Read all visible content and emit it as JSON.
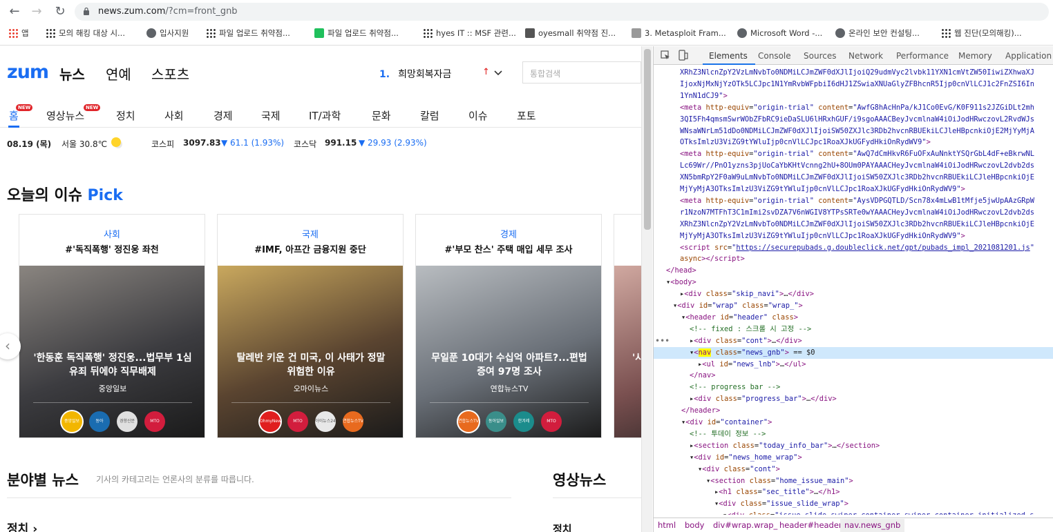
{
  "browser": {
    "url_host": "news.zum.com",
    "url_path": "/?cm=front_gnb",
    "bookmarks": [
      {
        "label": "앱",
        "icon": "apps-grid-icon"
      },
      {
        "label": "모의 해킹 대상 시...",
        "icon": "dots-icon"
      },
      {
        "label": "입사지원",
        "icon": "globe-icon"
      },
      {
        "label": "파일 업로드 취약점...",
        "icon": "dots-icon"
      },
      {
        "label": "파일 업로드 취약점...",
        "icon": "blog-icon"
      },
      {
        "label": "hyes IT :: MSF 관련...",
        "icon": "dots-icon"
      },
      {
        "label": "oyesmall 취약점 진...",
        "icon": "window-icon"
      },
      {
        "label": "3. Metasploit Fram...",
        "icon": "wiki-icon"
      },
      {
        "label": "Microsoft Word -...",
        "icon": "globe-icon"
      },
      {
        "label": "온라인 보안 컨설팅...",
        "icon": "globe-icon"
      },
      {
        "label": "웹 진단(모의해킹)...",
        "icon": "dots-icon"
      }
    ]
  },
  "site": {
    "logo": "zum",
    "top_tabs": [
      "뉴스",
      "연예",
      "스포츠"
    ],
    "rank_number": "1.",
    "rank_text": "희망회복자금",
    "rank_arrow": "↑",
    "search_placeholder": "통합검색",
    "gnb": [
      {
        "label": "홈",
        "new": true
      },
      {
        "label": "영상뉴스",
        "new": true
      },
      {
        "label": "정치",
        "new": false
      },
      {
        "label": "사회",
        "new": false
      },
      {
        "label": "경제",
        "new": false
      },
      {
        "label": "국제",
        "new": false
      },
      {
        "label": "IT/과학",
        "new": false
      },
      {
        "label": "문화",
        "new": false
      },
      {
        "label": "칼럼",
        "new": false
      },
      {
        "label": "이슈",
        "new": false
      },
      {
        "label": "포토",
        "new": false
      }
    ],
    "new_badge": "NEW",
    "info_bar": {
      "date": "08.19 (목)",
      "weather": "서울 30.8℃",
      "kospi_label": "코스피",
      "kospi_value": "3097.83",
      "kospi_change": "▼ 61.1 (1.93%)",
      "kosdaq_label": "코스닥",
      "kosdaq_value": "991.15",
      "kosdaq_change": "▼ 29.93 (2.93%)"
    },
    "issue_title": "오늘의 이슈",
    "issue_pick": "Pick",
    "cards": [
      {
        "category": "사회",
        "headline": "#'독직폭행' 정진웅 좌천",
        "caption": "'한동훈 독직폭행' 정진웅...법무부 1심 유죄 뒤에야 직무배제",
        "source": "중앙일보",
        "colors": [
          "#3c3c40",
          "#8a8580"
        ],
        "press": [
          {
            "name": "중앙일보",
            "color": "#f2b600"
          },
          {
            "name": "동아",
            "color": "#1a6cb0"
          },
          {
            "name": "경향신문",
            "color": "#e0e0e0"
          },
          {
            "name": "MTO",
            "color": "#d21d3d"
          }
        ]
      },
      {
        "category": "국제",
        "headline": "#IMF, 아프간 금융지원 중단",
        "caption": "탈레반 키운 건 미국, 이 사태가 정말 위험한 이유",
        "source": "오마이뉴스",
        "colors": [
          "#5a4430",
          "#c9a85e"
        ],
        "press": [
          {
            "name": "OhmyNews",
            "color": "#e01e1e"
          },
          {
            "name": "MTO",
            "color": "#d21d3d"
          },
          {
            "name": "아이뉴스24",
            "color": "#e8e8e8"
          },
          {
            "name": "연합뉴스TV",
            "color": "#e86a1e"
          }
        ]
      },
      {
        "category": "경제",
        "headline": "#'부모 찬스' 주택 매입 세무 조사",
        "caption": "무일푼 10대가 수십억 아파트?...편법증여 97명 조사",
        "source": "연합뉴스TV",
        "colors": [
          "#6a7078",
          "#b8bcc0"
        ],
        "press": [
          {
            "name": "연합뉴스TV",
            "color": "#e86a1e"
          },
          {
            "name": "동아일보",
            "color": "#3a8e8a"
          },
          {
            "name": "한겨레",
            "color": "#1b8c8c"
          },
          {
            "name": "MTO",
            "color": "#d21d3d"
          }
        ]
      },
      {
        "category": "",
        "headline": "",
        "caption": "'사",
        "source": "",
        "colors": [
          "#7a5050",
          "#d0a8a0"
        ],
        "press": []
      }
    ],
    "field_title": "분야별 뉴스",
    "field_desc": "기사의 카테고리는 언론사의 분류를 따릅니다.",
    "video_title": "영상뉴스",
    "politics_left": "정치 ›",
    "politics_right": "정치"
  },
  "devtools": {
    "tabs": [
      "Elements",
      "Console",
      "Sources",
      "Network",
      "Performance",
      "Memory",
      "Application"
    ],
    "active_tab": "Elements",
    "lines": [
      {
        "indent": 0,
        "html": "<span class='t-val'>XRhZ3NlcnZpY2VzLmNvbTo0NDMiLCJmZWF0dXJlIjoiQ29udmVyc2lvbk11YXN1cmVtZW50IiwiZXhwaXJ</span>"
      },
      {
        "indent": 0,
        "html": "<span class='t-val'>IjoxNjMxNjYzOTk5LCJpc1N1YmRvbWFpbiI6dHJ1ZSwiaXNUaGlyZFBhcnR5Ijp0cnVlLCJ1c2FnZSI6In</span>"
      },
      {
        "indent": 0,
        "html": "<span class='t-val'>1YnN1dCJ9\"</span><span class='t-tag'>&gt;</span>"
      },
      {
        "indent": 0,
        "html": "<span class='t-tag'>&lt;meta</span> <span class='t-attr'>http-equiv</span>=<span class='t-val'>\"origin-trial\"</span> <span class='t-attr'>content</span>=<span class='t-val'>\"AwfG8hAcHnPa/kJ1Co0EvG/K0F911s2JZGiDLt2mh</span>"
      },
      {
        "indent": 0,
        "html": "<span class='t-val'>3QI5Fh4qmsmSwrWObZFbRC9ieDaSLU6lHRxhGUF/i9sgoAAACBeyJvcmlnaW4iOiJodHRwczovL2RvdWJs</span>"
      },
      {
        "indent": 0,
        "html": "<span class='t-val'>WNsaWNrLm51dDo0NDMiLCJmZWF0dXJlIjoiSW50ZXJlc3RDb2hvcnRBUEkiLCJleHBpcnkiOjE2MjYyMjA</span>"
      },
      {
        "indent": 0,
        "html": "<span class='t-val'>OTksImlzU3ViZG9tYWluIjp0cnVlLCJpc1RoaXJkUGFydHkiOnRydWV9\"</span><span class='t-tag'>&gt;</span>"
      },
      {
        "indent": 0,
        "html": "<span class='t-tag'>&lt;meta</span> <span class='t-attr'>http-equiv</span>=<span class='t-val'>\"origin-trial\"</span> <span class='t-attr'>content</span>=<span class='t-val'>\"AwQ7dCmHkvR6FuOFxAuNnktYSQrGbL4dF+eBkrwNL</span>"
      },
      {
        "indent": 0,
        "html": "<span class='t-val'>Lc69Wr//PnO1yzns3pjUoCaYbKHtVcnng2hU+8OUm0PAYAAACHeyJvcmlnaW4iOiJodHRwczovL2dvb2ds</span>"
      },
      {
        "indent": 0,
        "html": "<span class='t-val'>XN5bmRpY2F0aW9uLmNvbTo0NDMiLCJmZWF0dXJlIjoiSW50ZXJlc3RDb2hvcnRBUEkiLCJleHBpcnkiOjE</span>"
      },
      {
        "indent": 0,
        "html": "<span class='t-val'>MjYyMjA3OTksImlzU3ViZG9tYWluIjp0cnVlLCJpc1RoaXJkUGFydHkiOnRydWV9\"</span><span class='t-tag'>&gt;</span>"
      },
      {
        "indent": 0,
        "html": "<span class='t-tag'>&lt;meta</span> <span class='t-attr'>http-equiv</span>=<span class='t-val'>\"origin-trial\"</span> <span class='t-attr'>content</span>=<span class='t-val'>\"AysVDPGQTLD/Scn78x4mLwB1tMfje5jwUpAAzGRpW</span>"
      },
      {
        "indent": 0,
        "html": "<span class='t-val'>r1NzoN7MTFhT3C1mImi2svDZA7V6nWGIV8YTPsSRTe0wYAAACHeyJvcmlnaW4iOiJodHRwczovL2dvb2ds</span>"
      },
      {
        "indent": 0,
        "html": "<span class='t-val'>XRhZ3NlcnZpY2VzLmNvbTo0NDMiLCJmZWF0dXJlIjoiSW50ZXJlc3RDb2hvcnRBUEkiLCJleHBpcnkiOjE</span>"
      },
      {
        "indent": 0,
        "html": "<span class='t-val'>MjYyMjA3OTksImlzU3ViZG9tYWluIjp0cnVlLCJpc1RoaXJkUGFydHkiOnRydWV9\"</span><span class='t-tag'>&gt;</span>"
      },
      {
        "indent": 0,
        "html": "<span class='t-tag'>&lt;script</span> <span class='t-attr'>src</span>=<span class='t-val'>\"</span><span class='t-link'>https://securepubads.g.doubleclick.net/gpt/pubads_impl_2021081201.js</span><span class='t-val'>\"</span>"
      },
      {
        "indent": 0,
        "html": "<span class='t-attr'>async</span><span class='t-tag'>&gt;&lt;/script&gt;</span>"
      },
      {
        "indent": -1,
        "html": "<span class='t-tag'>&lt;/head&gt;</span>"
      },
      {
        "indent": -1,
        "html": "<span class='t-txt'>▾</span><span class='t-tag'>&lt;body&gt;</span>"
      },
      {
        "indent": 0,
        "html": "<span class='t-txt'>▸</span><span class='t-tag'>&lt;div</span> <span class='t-attr'>class</span>=<span class='t-val'>\"skip_navi\"</span><span class='t-tag'>&gt;</span>…<span class='t-tag'>&lt;/div&gt;</span>"
      },
      {
        "indent": 0,
        "html": "<span class='t-txt'>▾</span><span class='t-tag'>&lt;div</span> <span class='t-attr'>id</span>=<span class='t-val'>\"wrap\"</span> <span class='t-attr'>class</span>=<span class='t-val'>\"wrap_\"</span><span class='t-tag'>&gt;</span>"
      },
      {
        "indent": 1,
        "html": "<span class='t-txt'>▾</span><span class='t-tag'>&lt;header</span> <span class='t-attr'>id</span>=<span class='t-val'>\"header\"</span> <span class='t-attr'>class</span><span class='t-tag'>&gt;</span>"
      },
      {
        "indent": 2,
        "html": "<span class='t-cmt'>&lt;!-- fixed : 스크롤 시 고정 --&gt;</span>"
      },
      {
        "indent": 2,
        "html": "<span class='t-txt'>▸</span><span class='t-tag'>&lt;div</span> <span class='t-attr'>class</span>=<span class='t-val'>\"cont\"</span><span class='t-tag'>&gt;</span>…<span class='t-tag'>&lt;/div&gt;</span>"
      },
      {
        "indent": 2,
        "sel": true,
        "html": "<span class='t-txt'>▾</span><span class='t-tag'>&lt;<span class='hl'>nav</span></span> <span class='t-attr'>class</span>=<span class='t-val'>\"news_gnb\"</span><span class='t-tag'>&gt;</span> <span class='t-txt'>== $0</span>"
      },
      {
        "indent": 3,
        "html": "<span class='t-txt'>▸</span><span class='t-tag'>&lt;ul</span> <span class='t-attr'>id</span>=<span class='t-val'>\"news_lnb\"</span><span class='t-tag'>&gt;</span>…<span class='t-tag'>&lt;/ul&gt;</span>"
      },
      {
        "indent": 2,
        "html": "<span class='t-tag'>&lt;/nav&gt;</span>"
      },
      {
        "indent": 2,
        "html": "<span class='t-cmt'>&lt;!-- progress bar --&gt;</span>"
      },
      {
        "indent": 2,
        "html": "<span class='t-txt'>▸</span><span class='t-tag'>&lt;div</span> <span class='t-attr'>class</span>=<span class='t-val'>\"progress_bar\"</span><span class='t-tag'>&gt;</span>…<span class='t-tag'>&lt;/div&gt;</span>"
      },
      {
        "indent": 1,
        "html": "<span class='t-tag'>&lt;/header&gt;</span>"
      },
      {
        "indent": 1,
        "html": "<span class='t-txt'>▾</span><span class='t-tag'>&lt;div</span> <span class='t-attr'>id</span>=<span class='t-val'>\"container\"</span><span class='t-tag'>&gt;</span>"
      },
      {
        "indent": 2,
        "html": "<span class='t-cmt'>&lt;!-- 투데이 정보 --&gt;</span>"
      },
      {
        "indent": 2,
        "html": "<span class='t-txt'>▸</span><span class='t-tag'>&lt;section</span> <span class='t-attr'>class</span>=<span class='t-val'>\"today_info_bar\"</span><span class='t-tag'>&gt;</span>…<span class='t-tag'>&lt;/section&gt;</span>"
      },
      {
        "indent": 2,
        "html": "<span class='t-txt'>▾</span><span class='t-tag'>&lt;div</span> <span class='t-attr'>id</span>=<span class='t-val'>\"news_home_wrap\"</span><span class='t-tag'>&gt;</span>"
      },
      {
        "indent": 3,
        "html": "<span class='t-txt'>▾</span><span class='t-tag'>&lt;div</span> <span class='t-attr'>class</span>=<span class='t-val'>\"cont\"</span><span class='t-tag'>&gt;</span>"
      },
      {
        "indent": 4,
        "html": "<span class='t-txt'>▾</span><span class='t-tag'>&lt;section</span> <span class='t-attr'>class</span>=<span class='t-val'>\"home_issue_main\"</span><span class='t-tag'>&gt;</span>"
      },
      {
        "indent": 5,
        "html": "<span class='t-txt'>▸</span><span class='t-tag'>&lt;h1</span> <span class='t-attr'>class</span>=<span class='t-val'>\"sec_title\"</span><span class='t-tag'>&gt;</span>…<span class='t-tag'>&lt;/h1&gt;</span>"
      },
      {
        "indent": 5,
        "html": "<span class='t-txt'>▾</span><span class='t-tag'>&lt;div</span> <span class='t-attr'>class</span>=<span class='t-val'>\"issue_slide_wrap\"</span><span class='t-tag'>&gt;</span>"
      },
      {
        "indent": 6,
        "html": "<span class='t-txt'>▾</span><span class='t-tag'>&lt;div</span> <span class='t-attr'>class</span>=<span class='t-val'>\"issue_slide swiper-container swiper-container-initialized s</span>"
      }
    ],
    "breadcrumbs": [
      "html",
      "body",
      "div#wrap.wrap_",
      "header#header",
      "nav.news_gnb"
    ]
  }
}
